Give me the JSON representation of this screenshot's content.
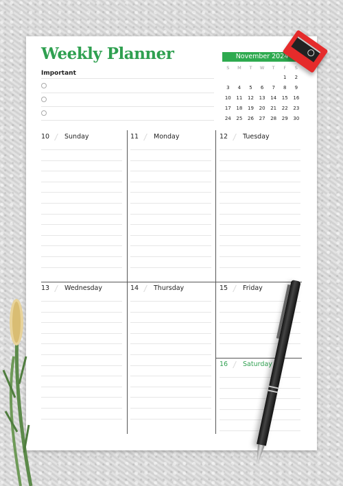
{
  "planner": {
    "title": "Weekly Planner",
    "important_label": "Important",
    "important_items": [
      "",
      "",
      ""
    ],
    "accent_color": "#2fa050"
  },
  "calendar": {
    "month_label": "November 2024",
    "weekdays": [
      "S",
      "M",
      "T",
      "W",
      "T",
      "F",
      "S"
    ],
    "cells": [
      "",
      "",
      "",
      "",
      "",
      "1",
      "2",
      "3",
      "4",
      "5",
      "6",
      "7",
      "8",
      "9",
      "10",
      "11",
      "12",
      "13",
      "14",
      "15",
      "16",
      "17",
      "18",
      "19",
      "20",
      "21",
      "22",
      "23",
      "24",
      "25",
      "26",
      "27",
      "28",
      "29",
      "30"
    ],
    "header_color": "#2eaa4f"
  },
  "days": [
    {
      "num": "10",
      "name": "Sunday"
    },
    {
      "num": "11",
      "name": "Monday"
    },
    {
      "num": "12",
      "name": "Tuesday"
    },
    {
      "num": "13",
      "name": "Wednesday"
    },
    {
      "num": "14",
      "name": "Thursday"
    },
    {
      "num": "15",
      "name": "Friday"
    },
    {
      "num": "16",
      "name": "Saturday"
    }
  ],
  "decor": [
    "pencil-sharpener",
    "pen",
    "plant-sprig"
  ]
}
